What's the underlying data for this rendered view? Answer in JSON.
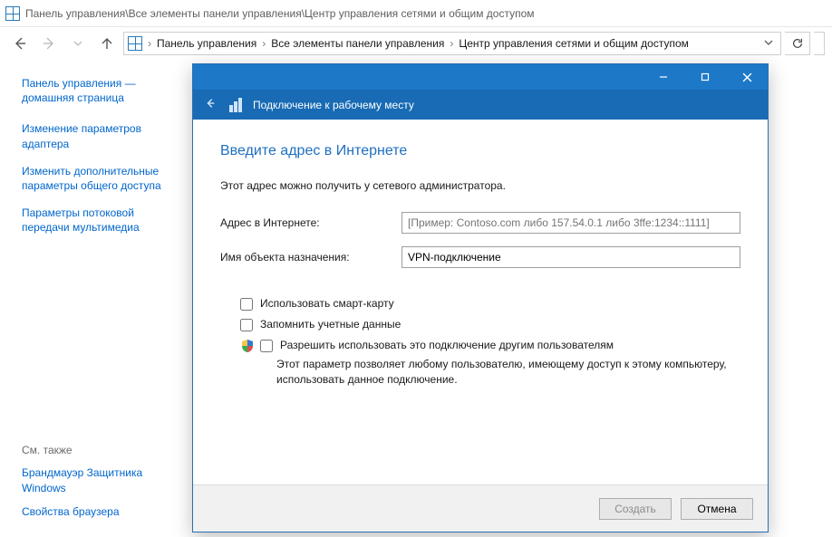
{
  "window": {
    "title": "Панель управления\\Все элементы панели управления\\Центр управления сетями и общим доступом"
  },
  "address": {
    "crumb1": "Панель управления",
    "crumb2": "Все элементы панели управления",
    "crumb3": "Центр управления сетями и общим доступом"
  },
  "sidebar": {
    "home": "Панель управления — домашняя страница",
    "links": [
      "Изменение параметров адаптера",
      "Изменить дополнительные параметры общего доступа",
      "Параметры потоковой передачи мультимедиа"
    ],
    "see_also_hdr": "См. также",
    "see_also": [
      "Брандмауэр Защитника Windows",
      "Свойства браузера"
    ]
  },
  "dialog": {
    "header": "Подключение к рабочему месту",
    "heading": "Введите адрес в Интернете",
    "sub": "Этот адрес можно получить у сетевого администратора.",
    "field_addr_label": "Адрес в Интернете:",
    "field_addr_placeholder": "[Пример: Contoso.com либо 157.54.0.1 либо 3ffe:1234::1111]",
    "field_dest_label": "Имя объекта назначения:",
    "field_dest_value": "VPN-подключение",
    "chk_smartcard": "Использовать смарт-карту",
    "chk_remember": "Запомнить учетные данные",
    "chk_share": "Разрешить использовать это подключение другим пользователям",
    "share_desc": "Этот параметр позволяет любому пользователю, имеющему доступ к этому компьютеру, использовать данное подключение.",
    "btn_create": "Создать",
    "btn_cancel": "Отмена"
  }
}
